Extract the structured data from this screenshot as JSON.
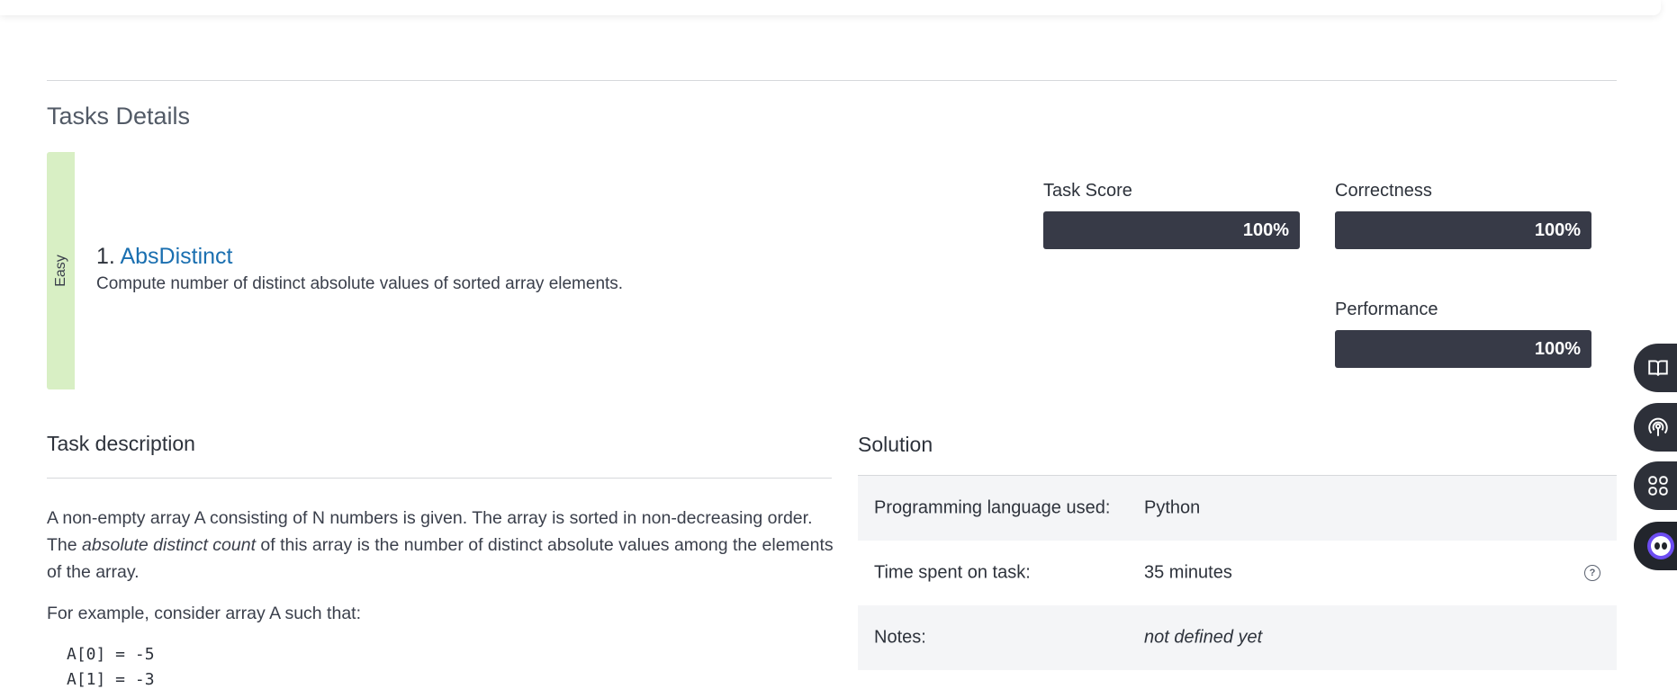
{
  "section": {
    "title": "Tasks Details"
  },
  "task": {
    "difficulty": "Easy",
    "number": "1.",
    "name": "AbsDistinct",
    "summary": "Compute number of distinct absolute values of sorted array elements."
  },
  "metrics": {
    "task_score": {
      "label": "Task Score",
      "value": "100%"
    },
    "correctness": {
      "label": "Correctness",
      "value": "100%"
    },
    "performance": {
      "label": "Performance",
      "value": "100%"
    }
  },
  "description": {
    "title": "Task description",
    "p1_a": "A non-empty array A consisting of N numbers is given. The array is sorted in non-decreasing order. The ",
    "p1_em": "absolute distinct count",
    "p1_b": " of this array is the number of distinct absolute values among the elements of the array.",
    "p2": "For example, consider array A such that:",
    "code": [
      "A[0] = -5",
      "A[1] = -3"
    ]
  },
  "solution": {
    "title": "Solution",
    "rows": [
      {
        "label": "Programming language used:",
        "value": "Python"
      },
      {
        "label": "Time spent on task:",
        "value": "35 minutes",
        "help": "?"
      },
      {
        "label": "Notes:",
        "value": "not defined yet"
      }
    ]
  },
  "side_buttons": [
    "book-icon",
    "broadcast-icon",
    "apps-grid-icon",
    "chatbot-icon"
  ]
}
